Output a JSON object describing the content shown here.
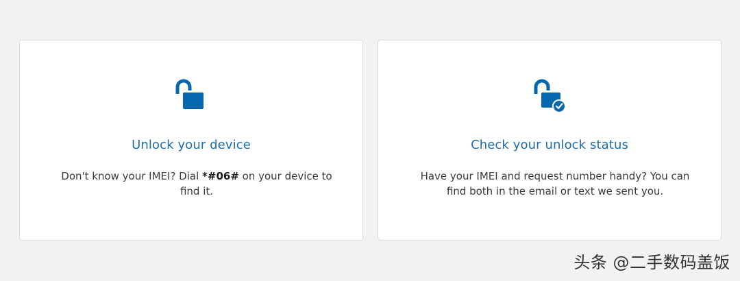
{
  "colors": {
    "background": "#f2f2f2",
    "card_background": "#ffffff",
    "accent_blue": "#0568ae",
    "title_blue": "#1d6ba8",
    "body_text": "#3a3a3a"
  },
  "cards": [
    {
      "icon": "unlocked-padlock-icon",
      "title": "Unlock your device",
      "description_before": "Don't know your IMEI? Dial ",
      "description_code": "*#06#",
      "description_after": " on your device to find it."
    },
    {
      "icon": "unlocked-padlock-check-icon",
      "title": "Check your unlock status",
      "description": "Have your IMEI and request number handy? You can find both in the email or text we sent you."
    }
  ],
  "watermark": "头条 @二手数码盖饭"
}
